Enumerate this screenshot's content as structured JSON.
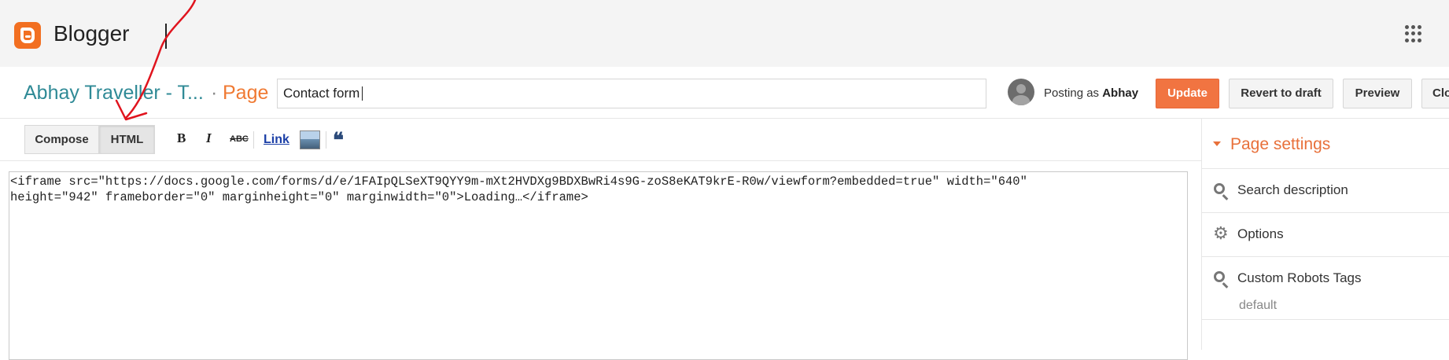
{
  "app": {
    "brand": "Blogger",
    "apps_icon": "grid-dots-icon"
  },
  "header": {
    "blog_title": "Abhay Traveller - T...",
    "separator": "·",
    "crumb": "Page",
    "title_value": "Contact form",
    "posting_prefix": "Posting as",
    "author": "Abhay"
  },
  "actions": {
    "update": "Update",
    "revert": "Revert to draft",
    "preview": "Preview",
    "close": "Clo"
  },
  "toolbar": {
    "compose": "Compose",
    "html": "HTML",
    "bold": "B",
    "italic": "I",
    "strike": "ABC",
    "link": "Link",
    "quote": "❝"
  },
  "editor": {
    "content": "<iframe src=\"https://docs.google.com/forms/d/e/1FAIpQLSeXT9QYY9m-mXt2HVDXg9BDXBwRi4s9G-zoS8eKAT9krE-R0w/viewform?embedded=true\" width=\"640\"\nheight=\"942\" frameborder=\"0\" marginheight=\"0\" marginwidth=\"0\">Loading…</iframe>"
  },
  "sidebar": {
    "title": "Page settings",
    "items": [
      {
        "label": "Search description",
        "icon": "search-icon"
      },
      {
        "label": "Options",
        "icon": "gear-icon"
      },
      {
        "label": "Custom Robots Tags",
        "icon": "search-icon",
        "value": "default"
      }
    ]
  },
  "colors": {
    "accent": "#f17441",
    "blog_title": "#2f8a96",
    "annotation": "#e0141e"
  }
}
